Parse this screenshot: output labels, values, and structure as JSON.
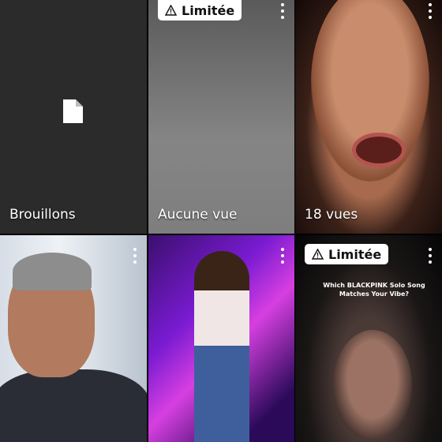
{
  "tiles": [
    {
      "label": "Brouillons",
      "type": "drafts",
      "icon": "document-icon"
    },
    {
      "label": "Aucune vue",
      "badge": "Limitée"
    },
    {
      "label": "18 vues"
    },
    {},
    {},
    {
      "badge": "Limitée",
      "overlay_title": "Which BLACKPINK Solo Song Matches Your Vibe?"
    }
  ],
  "colors": {
    "drafts_bg": "#2b2b2b",
    "badge_bg": "#ffffff"
  }
}
